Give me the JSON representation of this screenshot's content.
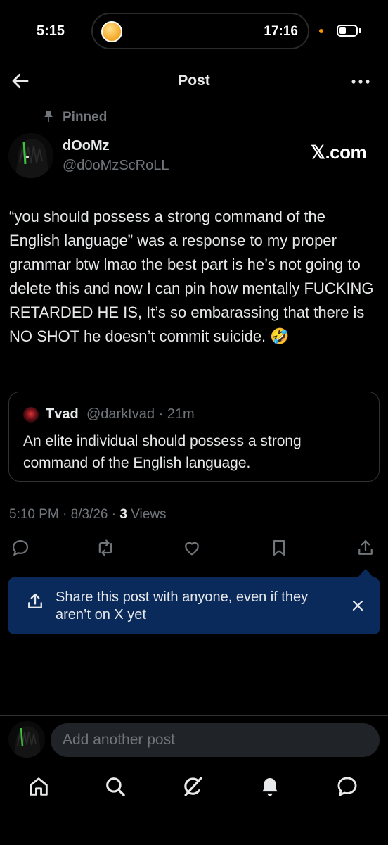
{
  "status_bar": {
    "time": "5:15",
    "island_time": "17:16"
  },
  "header": {
    "title": "Post"
  },
  "post": {
    "pinned_label": "Pinned",
    "author_name": "dOoMz",
    "author_handle": "@d0oMzScRoLL",
    "source_badge": "𝕏.com",
    "text": "“you should possess a strong command of the English language” was a response to my proper grammar btw lmao the best part is he’s not going to delete this and now I can pin how mentally FUCKING RETARDED HE IS, It’s so embarassing that there is NO SHOT he doesn’t commit suicide. 🤣",
    "quote": {
      "name": "Tvad",
      "meta": "@darktvad · 21m",
      "text": "An elite individual should possess a strong command of the English language."
    },
    "time": "5:10 PM · 8/3/26 · ",
    "views_count": "3",
    "views_label": " Views"
  },
  "actions": [
    "reply-icon",
    "repost-icon",
    "like-icon",
    "bookmark-icon",
    "share-icon"
  ],
  "share_banner": {
    "text": "Share this post with anyone, even if they aren’t on X yet"
  },
  "reply_bar": {
    "placeholder": "Add another post"
  },
  "bottom_nav": [
    "home-icon",
    "search-icon",
    "grok-icon",
    "notifications-icon",
    "messages-icon"
  ],
  "colors": {
    "background": "#000000",
    "text": "#e7e9ea",
    "muted": "#71767b",
    "banner": "#0b2a5c",
    "border": "#2f3336"
  }
}
